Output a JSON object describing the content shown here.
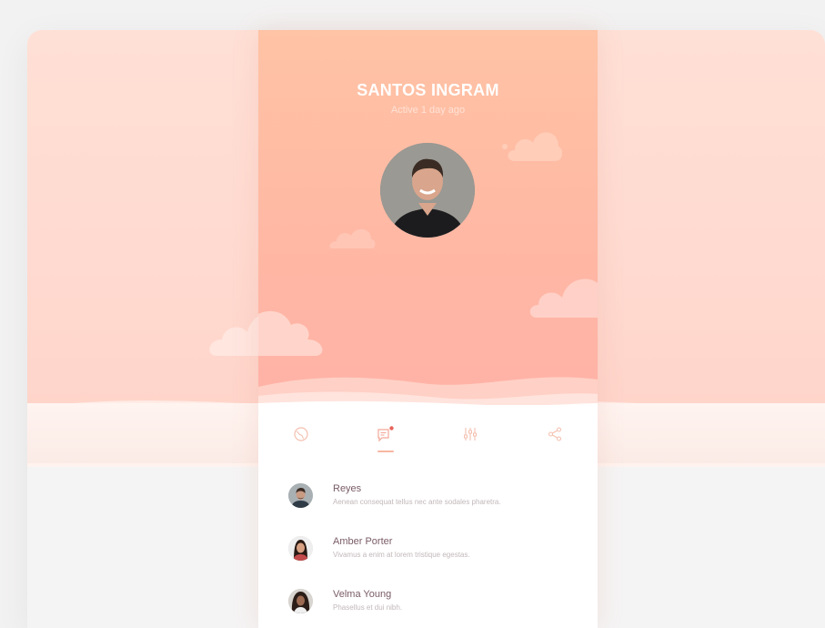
{
  "profile": {
    "name": "SANTOS INGRAM",
    "status": "Active 1 day ago",
    "avatar": "profile-photo"
  },
  "tabs": [
    {
      "icon": "globe-icon",
      "active": false
    },
    {
      "icon": "chat-notification-icon",
      "active": true
    },
    {
      "icon": "sliders-icon",
      "active": false
    },
    {
      "icon": "share-icon",
      "active": false
    }
  ],
  "contacts": [
    {
      "name": "Reyes",
      "message": "Aenean consequat tellus nec ante sodales pharetra."
    },
    {
      "name": "Amber Porter",
      "message": "Vivamus a enim at lorem tristique egestas."
    },
    {
      "name": "Velma Young",
      "message": "Phasellus et dui nibh."
    }
  ],
  "colors": {
    "accent": "#f8b7a2",
    "header_top": "#ffc3a5",
    "header_bottom": "#ffb2a6",
    "name_text": "#7a5c66"
  }
}
